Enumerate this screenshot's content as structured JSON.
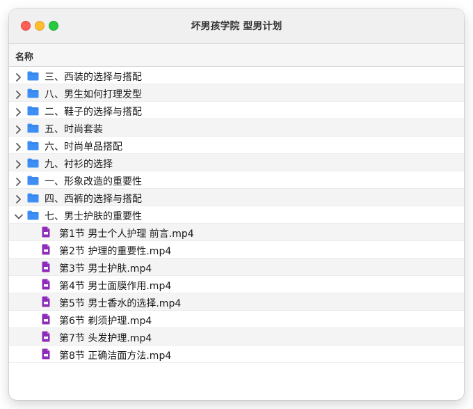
{
  "window": {
    "title": "坏男孩学院 型男计划"
  },
  "header": {
    "name_column": "名称"
  },
  "folders": [
    {
      "label": "三、西装的选择与搭配",
      "expanded": false
    },
    {
      "label": "八、男生如何打理发型",
      "expanded": false
    },
    {
      "label": "二、鞋子的选择与搭配",
      "expanded": false
    },
    {
      "label": "五、时尚套装",
      "expanded": false
    },
    {
      "label": "六、时尚单品搭配",
      "expanded": false
    },
    {
      "label": "九、衬衫的选择",
      "expanded": false
    },
    {
      "label": "一、形象改造的重要性",
      "expanded": false
    },
    {
      "label": "四、西裤的选择与搭配",
      "expanded": false
    },
    {
      "label": "七、男士护肤的重要性",
      "expanded": true
    }
  ],
  "files": [
    {
      "label": "第1节 男士个人护理 前言.mp4"
    },
    {
      "label": "第2节 护理的重要性.mp4"
    },
    {
      "label": "第3节 男士护肤.mp4"
    },
    {
      "label": "第4节 男士面膜作用.mp4"
    },
    {
      "label": "第5节 男士香水的选择.mp4"
    },
    {
      "label": "第6节 剃须护理.mp4"
    },
    {
      "label": "第7节 头发护理.mp4"
    },
    {
      "label": "第8节 正确洁面方法.mp4"
    }
  ],
  "colors": {
    "folder": "#3d8ef5",
    "file_icon": "#8e2bb8",
    "traffic_close": "#ff5f57",
    "traffic_minimize": "#febc2e",
    "traffic_zoom": "#28c840"
  }
}
